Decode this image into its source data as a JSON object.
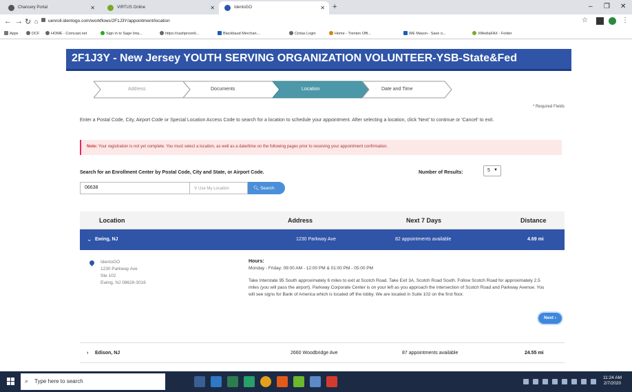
{
  "browser": {
    "tabs": [
      {
        "label": "Chancery Portal",
        "active": false
      },
      {
        "label": "VIRTUS Online",
        "active": false
      },
      {
        "label": "IdentoGO",
        "active": true
      }
    ],
    "url": "uenroll.identogo.com/workflows/2F1J3Y/appointment/location",
    "bookmarks": [
      "Apps",
      "DCF",
      "HOME - Comcast.net",
      "Sign in to Sage Inta...",
      "https://cashproonli...",
      "Blackbaud Merchan...",
      "Cintas Login",
      "Home - Trenton Offi...",
      "WE Mason - Save o...",
      "XMediaFAX - Folder"
    ]
  },
  "banner": {
    "title": "2F1J3Y - New Jersey YOUTH SERVING ORGANIZATION VOLUNTEER-YSB-State&Fed"
  },
  "steps": [
    "Address",
    "Documents",
    "Location",
    "Date and Time"
  ],
  "active_step": "Location",
  "required": "* Required Fields",
  "intro": "Enter a Postal Code, City, Airport Code or Special Location Access Code to search for a location to schedule your appointment. After selecting a location, click 'Next' to continue or 'Cancel' to exit.",
  "note": {
    "label": "Note:",
    "text": "Your registration is not yet complete. You must select a location, as well as a date/time on the following pages prior to receiving your appointment confirmation."
  },
  "search": {
    "label": "Search for an Enrollment Center by Postal Code, City and State, or Airport Code.",
    "value": "06638",
    "use_location": "Use My Location",
    "button": "Search",
    "num_label": "Number of Results:",
    "num_value": "5"
  },
  "table": {
    "headers": [
      "Location",
      "Address",
      "Next 7 Days",
      "Distance"
    ],
    "rows": [
      {
        "location": "Ewing, NJ",
        "address": "1230 Parkway Ave",
        "next7": "82 appointments available",
        "distance": "4.69 mi"
      },
      {
        "location": "Edison, NJ",
        "address": "2660 Woodbridge Ave",
        "next7": "87 appointments available",
        "distance": "24.55 mi"
      }
    ]
  },
  "detail": {
    "addr": [
      "IdentoGO",
      "1230 Parkway Ave",
      "Ste 102",
      "Ewing, NJ 08628-3016"
    ],
    "hours_label": "Hours:",
    "hours": "Monday - Friday: 09:00 AM - 12:00 PM & 01:00 PM - 05:00 PM",
    "directions": "Take Interstate 95 South approximately 6 miles to exit at Scotch Road. Take Exit 3A, Scotch Road South. Follow Scotch Road for approximately 2.5 miles (you will pass the airport). Parkway Corporate Center is on your left as you approach the intersection of Scotch Road and Parkway Avenue. You will see signs for Bank of America which is located off the lobby. We are located in Suite 102 on the first floor.",
    "next": "Next"
  },
  "taskbar": {
    "search": "Type here to search",
    "time": "11:24 AM",
    "date": "2/7/2020"
  },
  "colors": {
    "brand": "#2f54a8",
    "accent": "#3f86dd"
  }
}
